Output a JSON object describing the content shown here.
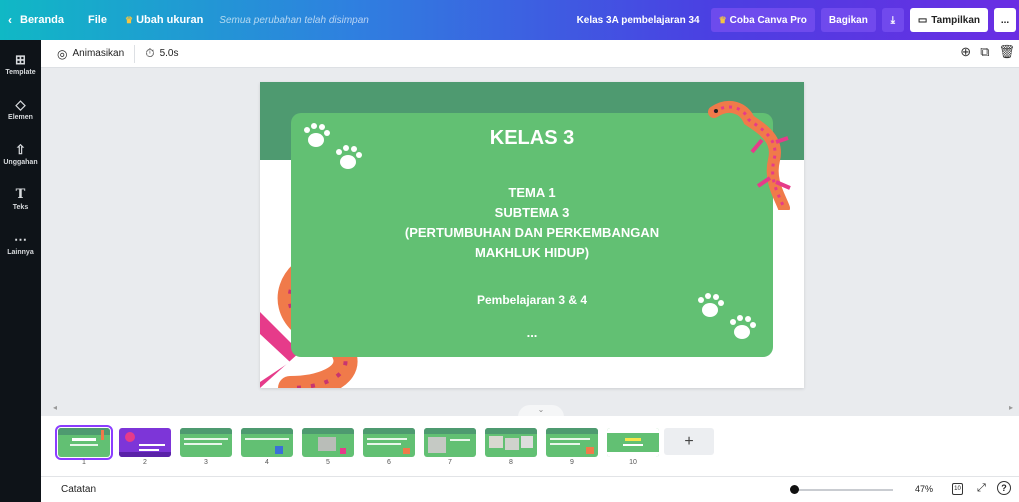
{
  "topbar": {
    "back_label": "Beranda",
    "file_label": "File",
    "resize_label": "Ubah ukuran",
    "saved_status": "Semua perubahan telah disimpan",
    "doc_title": "Kelas 3A pembelajaran 34",
    "pro_label": "Coba Canva Pro",
    "share_label": "Bagikan",
    "present_label": "Tampilkan",
    "more_label": "..."
  },
  "sidebar": {
    "items": [
      {
        "label": "Template",
        "icon": "template-icon"
      },
      {
        "label": "Elemen",
        "icon": "elements-icon"
      },
      {
        "label": "Unggahan",
        "icon": "upload-icon"
      },
      {
        "label": "Teks",
        "icon": "text-icon"
      },
      {
        "label": "Lainnya",
        "icon": "more-icon"
      }
    ]
  },
  "toolbar": {
    "animate_label": "Animasikan",
    "duration": "5.0s"
  },
  "slide": {
    "title": "KELAS 3",
    "line1": "TEMA 1",
    "line2": "SUBTEMA 3",
    "line3": "(PERTUMBUHAN DAN PERKEMBANGAN",
    "line4": "MAKHLUK HIDUP)",
    "subtitle": "Pembelajaran 3 & 4",
    "dots": "...",
    "colors": {
      "band": "#4e9a70",
      "card": "#62c073",
      "lizard": "#f07a4a",
      "snake": "#f07a4a"
    }
  },
  "filmstrip": {
    "pages": [
      {
        "num": "1",
        "color": "#62c073",
        "selected": true
      },
      {
        "num": "2",
        "color": "#7d35d8",
        "selected": false
      },
      {
        "num": "3",
        "color": "#62c073",
        "selected": false
      },
      {
        "num": "4",
        "color": "#62c073",
        "selected": false
      },
      {
        "num": "5",
        "color": "#62c073",
        "selected": false
      },
      {
        "num": "6",
        "color": "#62c073",
        "selected": false
      },
      {
        "num": "7",
        "color": "#62c073",
        "selected": false
      },
      {
        "num": "8",
        "color": "#62c073",
        "selected": false
      },
      {
        "num": "9",
        "color": "#62c073",
        "selected": false
      },
      {
        "num": "10",
        "color": "#62c073",
        "selected": false
      }
    ],
    "add_label": "+"
  },
  "bottombar": {
    "notes_label": "Catatan",
    "zoom": "47%",
    "page_count": "10",
    "zoom_level": 0.0
  }
}
